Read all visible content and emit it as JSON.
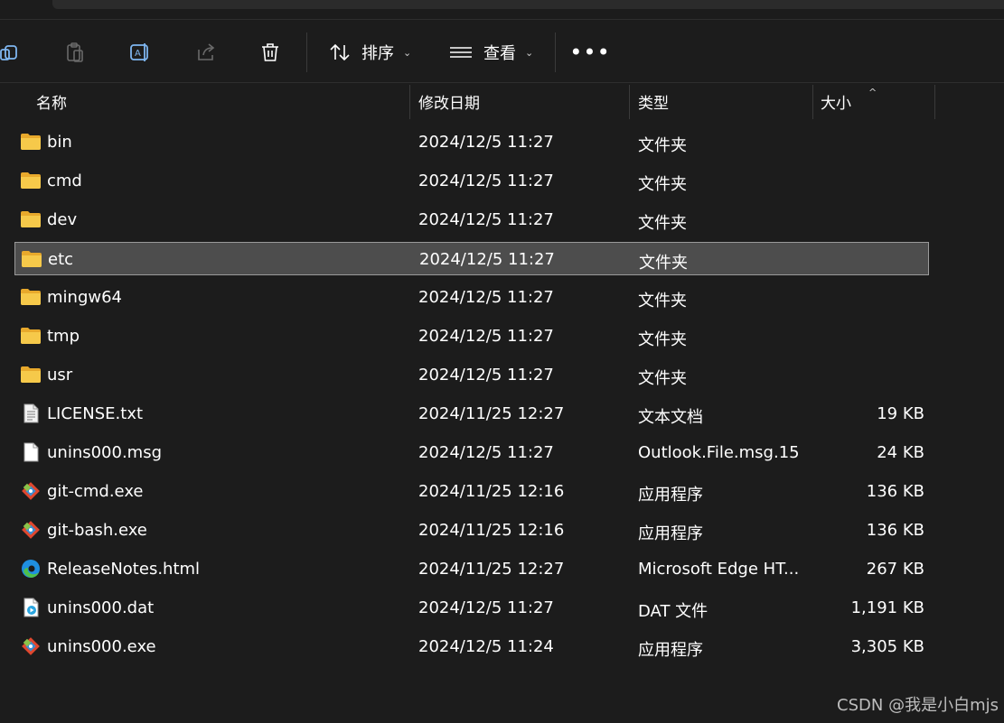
{
  "toolbar": {
    "copy_icon": "copy-icon",
    "paste_icon": "paste-icon",
    "rename_icon": "rename-icon",
    "share_icon": "share-icon",
    "delete_icon": "trash-icon",
    "sort_label": "排序",
    "view_label": "查看",
    "more_label": "•••"
  },
  "columns": {
    "name": "名称",
    "date": "修改日期",
    "type": "类型",
    "size": "大小"
  },
  "files": [
    {
      "name": "bin",
      "date": "2024/12/5 11:27",
      "type": "文件夹",
      "size": "",
      "icon": "folder-icon"
    },
    {
      "name": "cmd",
      "date": "2024/12/5 11:27",
      "type": "文件夹",
      "size": "",
      "icon": "folder-icon"
    },
    {
      "name": "dev",
      "date": "2024/12/5 11:27",
      "type": "文件夹",
      "size": "",
      "icon": "folder-icon"
    },
    {
      "name": "etc",
      "date": "2024/12/5 11:27",
      "type": "文件夹",
      "size": "",
      "icon": "folder-icon",
      "selected": true
    },
    {
      "name": "mingw64",
      "date": "2024/12/5 11:27",
      "type": "文件夹",
      "size": "",
      "icon": "folder-icon"
    },
    {
      "name": "tmp",
      "date": "2024/12/5 11:27",
      "type": "文件夹",
      "size": "",
      "icon": "folder-icon"
    },
    {
      "name": "usr",
      "date": "2024/12/5 11:27",
      "type": "文件夹",
      "size": "",
      "icon": "folder-icon"
    },
    {
      "name": "LICENSE.txt",
      "date": "2024/11/25 12:27",
      "type": "文本文档",
      "size": "19 KB",
      "icon": "text-file-icon"
    },
    {
      "name": "unins000.msg",
      "date": "2024/12/5 11:27",
      "type": "Outlook.File.msg.15",
      "size": "24 KB",
      "icon": "blank-file-icon"
    },
    {
      "name": "git-cmd.exe",
      "date": "2024/11/25 12:16",
      "type": "应用程序",
      "size": "136 KB",
      "icon": "git-icon"
    },
    {
      "name": "git-bash.exe",
      "date": "2024/11/25 12:16",
      "type": "应用程序",
      "size": "136 KB",
      "icon": "git-icon"
    },
    {
      "name": "ReleaseNotes.html",
      "date": "2024/11/25 12:27",
      "type": "Microsoft Edge HT...",
      "size": "267 KB",
      "icon": "edge-icon"
    },
    {
      "name": "unins000.dat",
      "date": "2024/12/5 11:27",
      "type": "DAT 文件",
      "size": "1,191 KB",
      "icon": "media-file-icon"
    },
    {
      "name": "unins000.exe",
      "date": "2024/12/5 11:24",
      "type": "应用程序",
      "size": "3,305 KB",
      "icon": "git-icon"
    }
  ],
  "watermark": "CSDN @我是小白mjs",
  "colors": {
    "background": "#1c1c1c",
    "selected_row": "#4d4d4d",
    "folder": "#f4c13f",
    "edge_blue": "#1f8fe0",
    "edge_green": "#4fc14b",
    "git_red": "#e0472e"
  }
}
